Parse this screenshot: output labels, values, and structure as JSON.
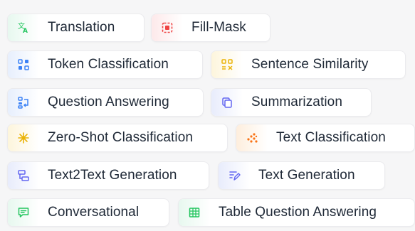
{
  "tasks": [
    {
      "label": "Translation",
      "icon": "translate-icon",
      "color": "#22c55e"
    },
    {
      "label": "Fill-Mask",
      "icon": "fill-mask-icon",
      "color": "#ef4444"
    },
    {
      "label": "Token Classification",
      "icon": "token-classification-icon",
      "color": "#3b82f6"
    },
    {
      "label": "Sentence Similarity",
      "icon": "sentence-similarity-icon",
      "color": "#eab308"
    },
    {
      "label": "Question Answering",
      "icon": "question-answering-icon",
      "color": "#3b82f6"
    },
    {
      "label": "Summarization",
      "icon": "summarization-icon",
      "color": "#6366f1"
    },
    {
      "label": "Zero-Shot Classification",
      "icon": "zero-shot-icon",
      "color": "#eab308"
    },
    {
      "label": "Text Classification",
      "icon": "text-classification-icon",
      "color": "#f97316"
    },
    {
      "label": "Text2Text Generation",
      "icon": "text2text-icon",
      "color": "#6366f1"
    },
    {
      "label": "Text Generation",
      "icon": "text-generation-icon",
      "color": "#6366f1"
    },
    {
      "label": "Conversational",
      "icon": "chat-icon",
      "color": "#22c55e"
    },
    {
      "label": "Table Question Answering",
      "icon": "table-icon",
      "color": "#22c55e"
    }
  ]
}
